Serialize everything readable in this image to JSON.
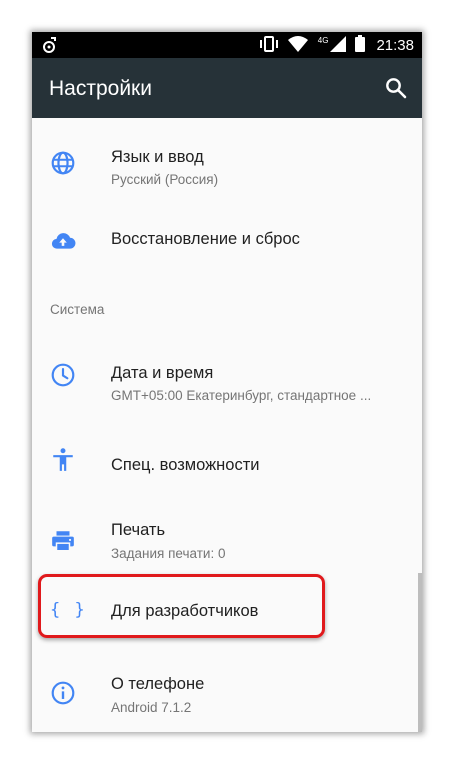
{
  "status_bar": {
    "network_label": "4G",
    "time": "21:38",
    "icons": [
      "music-notification-icon",
      "vibrate-icon",
      "wifi-icon",
      "cellular-signal-icon",
      "battery-icon"
    ]
  },
  "app_bar": {
    "title": "Настройки",
    "search_icon": "search-icon",
    "background": "#263238"
  },
  "items": [
    {
      "title": "Язык и ввод",
      "summary": "Русский (Россия)",
      "icon": "globe-icon"
    },
    {
      "title": "Восстановление и сброс",
      "summary": "",
      "icon": "cloud-upload-icon"
    }
  ],
  "section": {
    "header": "Система"
  },
  "system_items": [
    {
      "title": "Дата и время",
      "summary": "GMT+05:00 Екатеринбург, стандартное ...",
      "icon": "clock-icon"
    },
    {
      "title": "Спец. возможности",
      "summary": "",
      "icon": "accessibility-icon"
    },
    {
      "title": "Печать",
      "summary": "Задания печати: 0",
      "icon": "print-icon"
    },
    {
      "title": "Для разработчиков",
      "summary": "",
      "icon": "developer-braces-icon",
      "highlighted": true
    },
    {
      "title": "О телефоне",
      "summary": "Android 7.1.2",
      "icon": "info-icon"
    }
  ],
  "colors": {
    "accent": "#4285f4",
    "highlight": "#e0191c",
    "primary_text": "#212121",
    "secondary_text": "#757575"
  }
}
